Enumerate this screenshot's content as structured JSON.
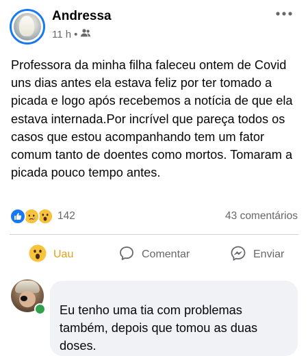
{
  "post": {
    "author": "Andressa",
    "time": "11 h",
    "separator": "•",
    "privacy_icon": "friends-icon",
    "text": "Professora da minha filha faleceu ontem de Covid uns dias antes ela estava feliz por ter tomado a picada e logo após recebemos a notícia de que ela estava internada.Por incrível que pareça todos os casos que estou acompanhando tem um fator comum tanto de doentes como mortos. Tomaram a picada pouco tempo antes."
  },
  "reactions": {
    "icons": [
      "like-icon",
      "sad-icon",
      "wow-icon"
    ],
    "count": "142",
    "comments_label": "43 comentários"
  },
  "actions": {
    "react_label": "Uau",
    "comment_label": "Comentar",
    "share_label": "Enviar"
  },
  "comment": {
    "text": "Eu tenho uma tia com problemas também, depois que tomou as duas doses."
  },
  "colors": {
    "accent": "#1877f2",
    "wow": "#f7b125",
    "muted": "#65676b",
    "online": "#31a24c",
    "bubble": "#f0f2f5"
  }
}
